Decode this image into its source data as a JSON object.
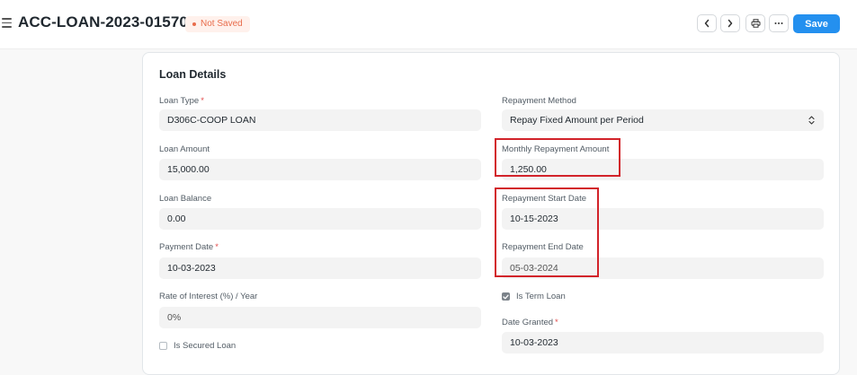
{
  "header": {
    "title": "ACC-LOAN-2023-01570",
    "status": "Not Saved",
    "save_label": "Save"
  },
  "section": {
    "title": "Loan Details"
  },
  "left_fields": {
    "loan_type": {
      "label": "Loan Type",
      "value": "D306C-COOP LOAN"
    },
    "loan_amount": {
      "label": "Loan Amount",
      "value": "15,000.00"
    },
    "loan_balance": {
      "label": "Loan Balance",
      "value": "0.00"
    },
    "payment_date": {
      "label": "Payment Date",
      "value": "10-03-2023"
    },
    "rate_of_interest": {
      "label": "Rate of Interest (%) / Year",
      "value": "0%"
    },
    "is_secured_loan": {
      "label": "Is Secured Loan",
      "checked": false
    }
  },
  "right_fields": {
    "repayment_method": {
      "label": "Repayment Method",
      "value": "Repay Fixed Amount per Period"
    },
    "monthly_repayment": {
      "label": "Monthly Repayment Amount",
      "value": "1,250.00"
    },
    "repayment_start": {
      "label": "Repayment Start Date",
      "value": "10-15-2023"
    },
    "repayment_end": {
      "label": "Repayment End Date",
      "value": "05-03-2024"
    },
    "is_term_loan": {
      "label": "Is Term Loan",
      "checked": true
    },
    "date_granted": {
      "label": "Date Granted",
      "value": "10-03-2023"
    }
  },
  "icons": {
    "menu": "hamburger-icon",
    "prev": "chevron-left-icon",
    "next": "chevron-right-icon",
    "print": "printer-icon",
    "more": "more-horizontal-icon"
  },
  "colors": {
    "primary": "#2490ef",
    "badge_text": "#e86c4b",
    "badge_bg": "#fff1ec",
    "required": "#e24c4c",
    "highlight": "#d2232a"
  }
}
